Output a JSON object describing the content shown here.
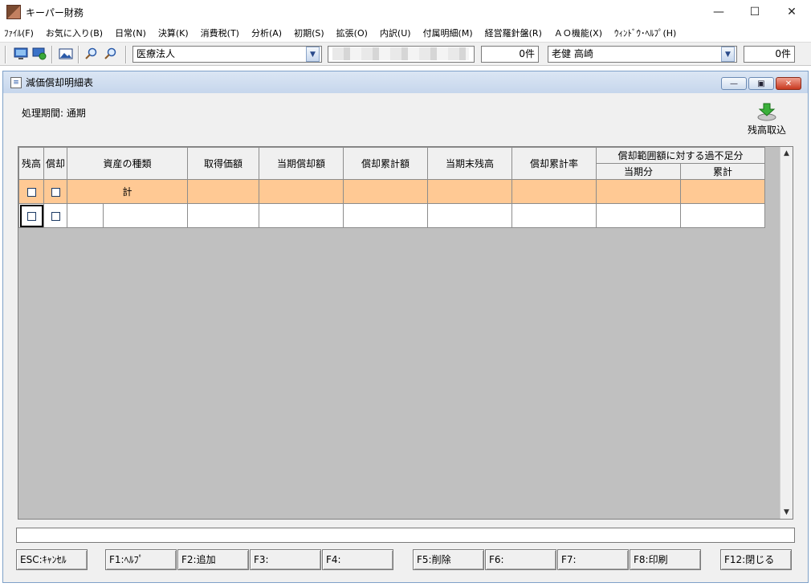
{
  "app": {
    "title": "キーパー財務"
  },
  "menu": [
    "ﾌｧｲﾙ(F)",
    "お気に入り(B)",
    "日常(N)",
    "決算(K)",
    "消費税(T)",
    "分析(A)",
    "初期(S)",
    "拡張(O)",
    "内訳(U)",
    "付属明細(M)",
    "経営羅針盤(R)",
    "ＡＯ機能(X)",
    "ｳｨﾝﾄﾞｳ･ﾍﾙﾌﾟ(H)"
  ],
  "toolbar": {
    "company_type": "医療法人",
    "count1": "0件",
    "person": "老健 高崎",
    "count2": "0件"
  },
  "window": {
    "title": "減価償却明細表",
    "period_label": "処理期間: 通期",
    "import_button": "残高取込"
  },
  "grid": {
    "headers": {
      "balance": "残高",
      "depreciation": "償却",
      "asset_type": "資産の種類",
      "acquisition": "取得価額",
      "current_dep": "当期償却額",
      "accum_dep": "償却累計額",
      "period_end_balance": "当期末残高",
      "accum_rate": "償却累計率",
      "excess_group": "償却範囲額に対する過不足分",
      "current_period": "当期分",
      "cumulative": "累計"
    },
    "total_label": "計"
  },
  "fkeys": [
    "ESC:ｷｬﾝｾﾙ",
    "F1:ﾍﾙﾌﾟ",
    "F2:追加",
    "F3:",
    "F4:",
    "F5:削除",
    "F6:",
    "F7:",
    "F8:印刷",
    "F12:閉じる"
  ],
  "colors": {
    "total_row": "#ffc994",
    "grid_background": "#c0c0c0",
    "window_title": "#c6d6ec"
  }
}
